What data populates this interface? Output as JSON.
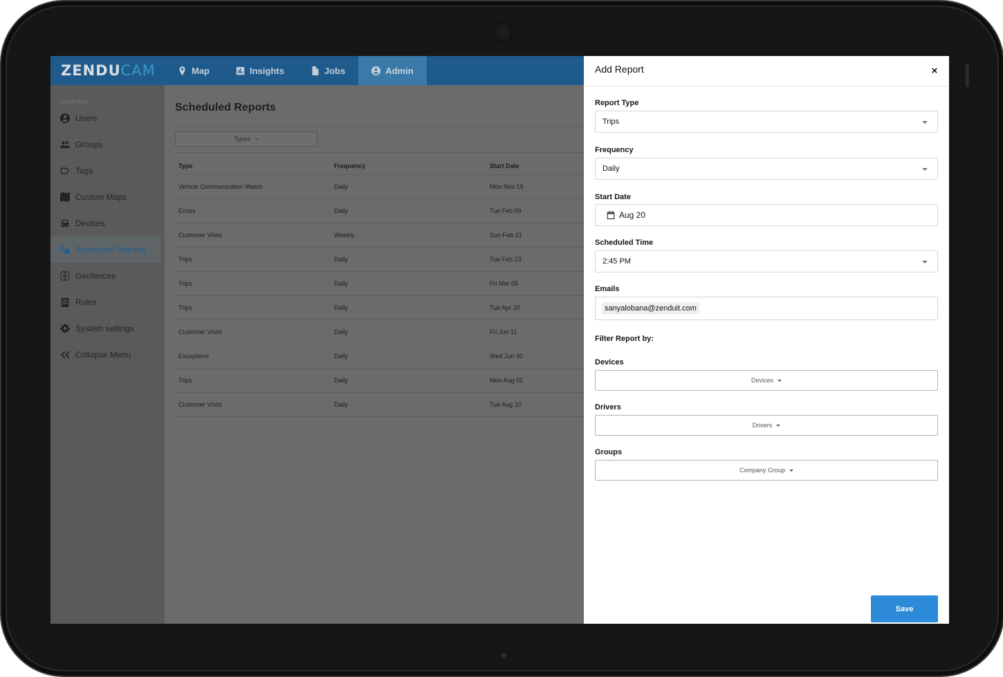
{
  "app": {
    "logo_main": "ZENDU",
    "logo_accent": "CAM"
  },
  "nav": {
    "tabs": [
      {
        "label": "Map",
        "icon": "map-pin-icon"
      },
      {
        "label": "Insights",
        "icon": "chart-icon"
      },
      {
        "label": "Jobs",
        "icon": "document-icon"
      },
      {
        "label": "Admin",
        "icon": "user-circle-icon",
        "active": true
      }
    ]
  },
  "sidebar": {
    "section": "COMPANY",
    "items": [
      {
        "label": "Users",
        "icon": "user-icon"
      },
      {
        "label": "Groups",
        "icon": "groups-icon"
      },
      {
        "label": "Tags",
        "icon": "tag-icon"
      },
      {
        "label": "Custom Maps",
        "icon": "map-icon"
      },
      {
        "label": "Devices",
        "icon": "car-icon"
      },
      {
        "label": "Scheduled Reports",
        "icon": "scheduled-report-icon",
        "active": true
      },
      {
        "label": "Geofences",
        "icon": "globe-icon"
      },
      {
        "label": "Rules",
        "icon": "rules-icon"
      },
      {
        "label": "System settings",
        "icon": "gear-icon"
      },
      {
        "label": "Collapse Menu",
        "icon": "double-chevron-left-icon"
      }
    ]
  },
  "main": {
    "title": "Scheduled Reports",
    "types_filter": "Types",
    "table": {
      "columns": [
        "Type",
        "Frequency",
        "Start Date"
      ],
      "rows": [
        [
          "Vehicle Communication Watch",
          "Daily",
          "Mon Nov 19"
        ],
        [
          "Errors",
          "Daily",
          "Tue Feb 09"
        ],
        [
          "Customer Visits",
          "Weekly",
          "Sun Feb 21"
        ],
        [
          "Trips",
          "Daily",
          "Tue Feb 23"
        ],
        [
          "Trips",
          "Daily",
          "Fri Mar 05"
        ],
        [
          "Trips",
          "Daily",
          "Tue Apr 20"
        ],
        [
          "Customer Visits",
          "Daily",
          "Fri Jun 11"
        ],
        [
          "Exceptions",
          "Daily",
          "Wed Jun 30"
        ],
        [
          "Trips",
          "Daily",
          "Mon Aug 02"
        ],
        [
          "Customer Visits",
          "Daily",
          "Tue Aug 10"
        ]
      ]
    }
  },
  "panel": {
    "title": "Add Report",
    "close": "×",
    "report_type": {
      "label": "Report Type",
      "value": "Trips"
    },
    "frequency": {
      "label": "Frequency",
      "value": "Daily"
    },
    "start_date": {
      "label": "Start Date",
      "value": "Aug 20"
    },
    "scheduled_time": {
      "label": "Scheduled Time",
      "value": "2:45 PM"
    },
    "emails": {
      "label": "Emails",
      "value": "sanyalobana@zenduit.com"
    },
    "filter_heading": "Filter Report by:",
    "devices": {
      "label": "Devices",
      "button": "Devices"
    },
    "drivers": {
      "label": "Drivers",
      "button": "Drivers"
    },
    "groups": {
      "label": "Groups",
      "button": "Company Group"
    },
    "save": "Save"
  },
  "colors": {
    "nav_bg": "#1f5a8c",
    "accent": "#2d8ad8",
    "overlay_dim": "#6b6b6b"
  }
}
